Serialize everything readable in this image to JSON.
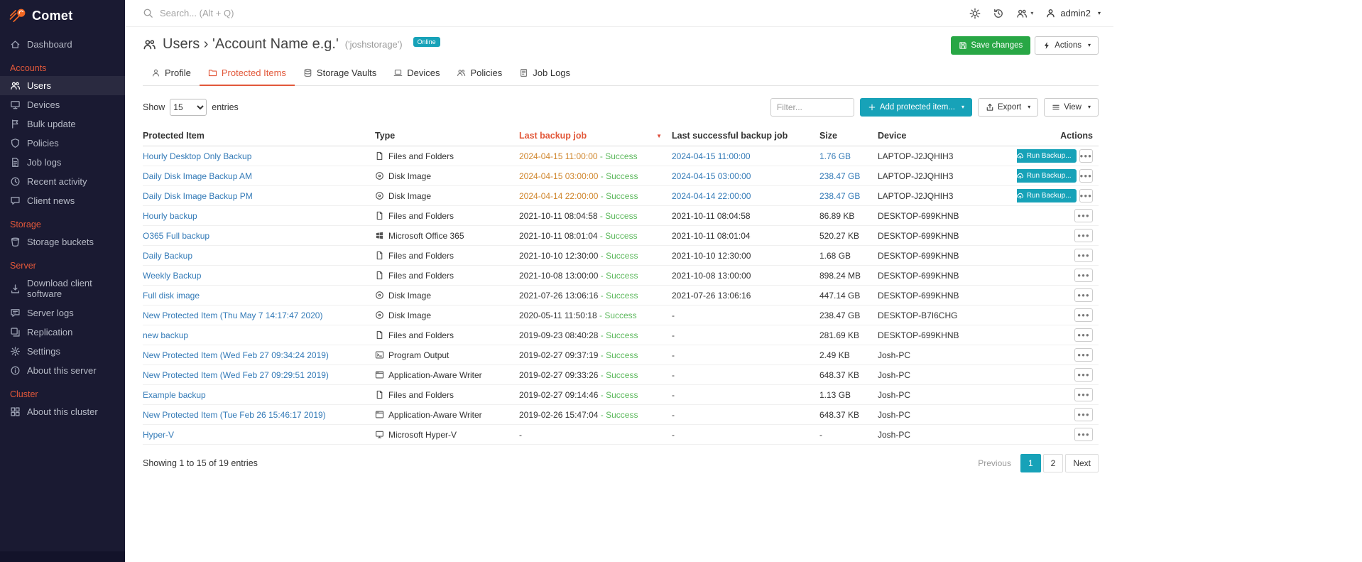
{
  "colors": {
    "accent": "#e2583a",
    "teal": "#17a2b8",
    "green": "#28a745",
    "link": "#337ab7",
    "success": "#5cb85c",
    "warn": "#d0862d",
    "red": "#dd4b39",
    "sidebar_bg": "#1a1a32",
    "brand_orange": "#f26722"
  },
  "sidebar": {
    "logo": "Comet",
    "sections": [
      {
        "items": [
          {
            "label": "Dashboard",
            "icon": "home"
          }
        ]
      },
      {
        "header": "Accounts",
        "items": [
          {
            "label": "Users",
            "icon": "users",
            "active": true
          },
          {
            "label": "Devices",
            "icon": "monitor"
          },
          {
            "label": "Bulk update",
            "icon": "flag"
          },
          {
            "label": "Policies",
            "icon": "shield"
          },
          {
            "label": "Job logs",
            "icon": "file-text"
          },
          {
            "label": "Recent activity",
            "icon": "clock"
          },
          {
            "label": "Client news",
            "icon": "chat"
          }
        ]
      },
      {
        "header": "Storage",
        "items": [
          {
            "label": "Storage buckets",
            "icon": "bucket"
          }
        ]
      },
      {
        "header": "Server",
        "items": [
          {
            "label": "Download client software",
            "icon": "download"
          },
          {
            "label": "Server logs",
            "icon": "chat-lines"
          },
          {
            "label": "Replication",
            "icon": "copy"
          },
          {
            "label": "Settings",
            "icon": "gear"
          },
          {
            "label": "About this server",
            "icon": "info"
          }
        ]
      },
      {
        "header": "Cluster",
        "items": [
          {
            "label": "About this cluster",
            "icon": "grid"
          }
        ]
      }
    ]
  },
  "topbar": {
    "search_placeholder": "Search... (Alt + Q)",
    "username": "admin2"
  },
  "header": {
    "title_user": "Users",
    "title_sep": "›",
    "title_account": "'Account Name e.g.'",
    "title_code": "('joshstorage')",
    "badge": "Online",
    "save_button": "Save changes",
    "actions_button": "Actions"
  },
  "tabs": [
    {
      "label": "Profile",
      "icon": "person"
    },
    {
      "label": "Protected Items",
      "icon": "folder",
      "active": true
    },
    {
      "label": "Storage Vaults",
      "icon": "database"
    },
    {
      "label": "Devices",
      "icon": "laptop"
    },
    {
      "label": "Policies",
      "icon": "users"
    },
    {
      "label": "Job Logs",
      "icon": "clipboard"
    }
  ],
  "controls": {
    "show_label": "Show",
    "page_size": "15",
    "entries_label": "entries",
    "filter_placeholder": "Filter...",
    "add_button": "Add protected item...",
    "export_button": "Export",
    "view_button": "View"
  },
  "table": {
    "run_backup_label": "Run Backup...",
    "columns": [
      {
        "label": "Protected Item"
      },
      {
        "label": "Type"
      },
      {
        "label": "Last backup job",
        "highlight": true,
        "sort_caret": true
      },
      {
        "label": "Last successful backup job"
      },
      {
        "label": "Size"
      },
      {
        "label": "Device"
      },
      {
        "label": "Actions",
        "align": "right",
        "sortable": false
      }
    ],
    "rows": [
      {
        "name": "Hourly Desktop Only Backup",
        "type": "Files and Folders",
        "icon": "files",
        "last_backup": "2024-04-15 11:00:00",
        "status": "Success",
        "last_successful": "2024-04-15 11:00:00",
        "size": "1.76 GB",
        "device": "LAPTOP-J2JQHIH3",
        "run_backup": true,
        "linked": true
      },
      {
        "name": "Daily Disk Image Backup AM",
        "type": "Disk Image",
        "icon": "disk",
        "last_backup": "2024-04-15 03:00:00",
        "status": "Success",
        "last_successful": "2024-04-15 03:00:00",
        "size": "238.47 GB",
        "device": "LAPTOP-J2JQHIH3",
        "run_backup": true,
        "linked": true
      },
      {
        "name": "Daily Disk Image Backup PM",
        "type": "Disk Image",
        "icon": "disk",
        "last_backup": "2024-04-14 22:00:00",
        "status": "Success",
        "last_successful": "2024-04-14 22:00:00",
        "size": "238.47 GB",
        "device": "LAPTOP-J2JQHIH3",
        "run_backup": true,
        "linked": true
      },
      {
        "name": "Hourly backup",
        "type": "Files and Folders",
        "icon": "files",
        "last_backup": "2021-10-11 08:04:58",
        "status": "Success",
        "last_successful": "2021-10-11 08:04:58",
        "size": "86.89 KB",
        "device": "DESKTOP-699KHNB"
      },
      {
        "name": "O365 Full backup",
        "type": "Microsoft Office 365",
        "icon": "o365",
        "last_backup": "2021-10-11 08:01:04",
        "status": "Success",
        "last_successful": "2021-10-11 08:01:04",
        "size": "520.27 KB",
        "device": "DESKTOP-699KHNB"
      },
      {
        "name": "Daily Backup",
        "type": "Files and Folders",
        "icon": "files",
        "last_backup": "2021-10-10 12:30:00",
        "status": "Success",
        "last_successful": "2021-10-10 12:30:00",
        "size": "1.68 GB",
        "device": "DESKTOP-699KHNB"
      },
      {
        "name": "Weekly Backup",
        "type": "Files and Folders",
        "icon": "files",
        "last_backup": "2021-10-08 13:00:00",
        "status": "Success",
        "last_successful": "2021-10-08 13:00:00",
        "size": "898.24 MB",
        "device": "DESKTOP-699KHNB"
      },
      {
        "name": "Full disk image",
        "type": "Disk Image",
        "icon": "disk",
        "last_backup": "2021-07-26 13:06:16",
        "status": "Success",
        "last_successful": "2021-07-26 13:06:16",
        "size": "447.14 GB",
        "device": "DESKTOP-699KHNB"
      },
      {
        "name": "New Protected Item (Thu May 7 14:17:47 2020)",
        "type": "Disk Image",
        "icon": "disk",
        "last_backup": "2020-05-11 11:50:18",
        "status": "Success",
        "last_successful": "-",
        "size": "238.47 GB",
        "device": "DESKTOP-B7I6CHG"
      },
      {
        "name": "new backup",
        "type": "Files and Folders",
        "icon": "files",
        "last_backup": "2019-09-23 08:40:28",
        "status": "Success",
        "last_successful": "-",
        "size": "281.69 KB",
        "device": "DESKTOP-699KHNB"
      },
      {
        "name": "New Protected Item (Wed Feb 27 09:34:24 2019)",
        "type": "Program Output",
        "icon": "program",
        "last_backup": "2019-02-27 09:37:19",
        "status": "Success",
        "last_successful": "-",
        "size": "2.49 KB",
        "device": "Josh-PC"
      },
      {
        "name": "New Protected Item (Wed Feb 27 09:29:51 2019)",
        "type": "Application-Aware Writer",
        "icon": "appaware",
        "last_backup": "2019-02-27 09:33:26",
        "status": "Success",
        "last_successful": "-",
        "size": "648.37 KB",
        "device": "Josh-PC"
      },
      {
        "name": "Example backup",
        "type": "Files and Folders",
        "icon": "files",
        "last_backup": "2019-02-27 09:14:46",
        "status": "Success",
        "last_successful": "-",
        "size": "1.13 GB",
        "device": "Josh-PC"
      },
      {
        "name": "New Protected Item (Tue Feb 26 15:46:17 2019)",
        "type": "Application-Aware Writer",
        "icon": "appaware",
        "last_backup": "2019-02-26 15:47:04",
        "status": "Success",
        "last_successful": "-",
        "size": "648.37 KB",
        "device": "Josh-PC"
      },
      {
        "name": "Hyper-V",
        "type": "Microsoft Hyper-V",
        "icon": "hyperv",
        "last_backup": "-",
        "last_successful": "-",
        "size": "-",
        "device": "Josh-PC"
      }
    ],
    "footer": {
      "showing_text": "Showing 1 to 15 of 19 entries",
      "pagination": [
        {
          "label": "Previous",
          "type": "muted"
        },
        {
          "label": "1",
          "type": "active"
        },
        {
          "label": "2",
          "type": "box"
        },
        {
          "label": "Next",
          "type": "box"
        }
      ]
    }
  }
}
